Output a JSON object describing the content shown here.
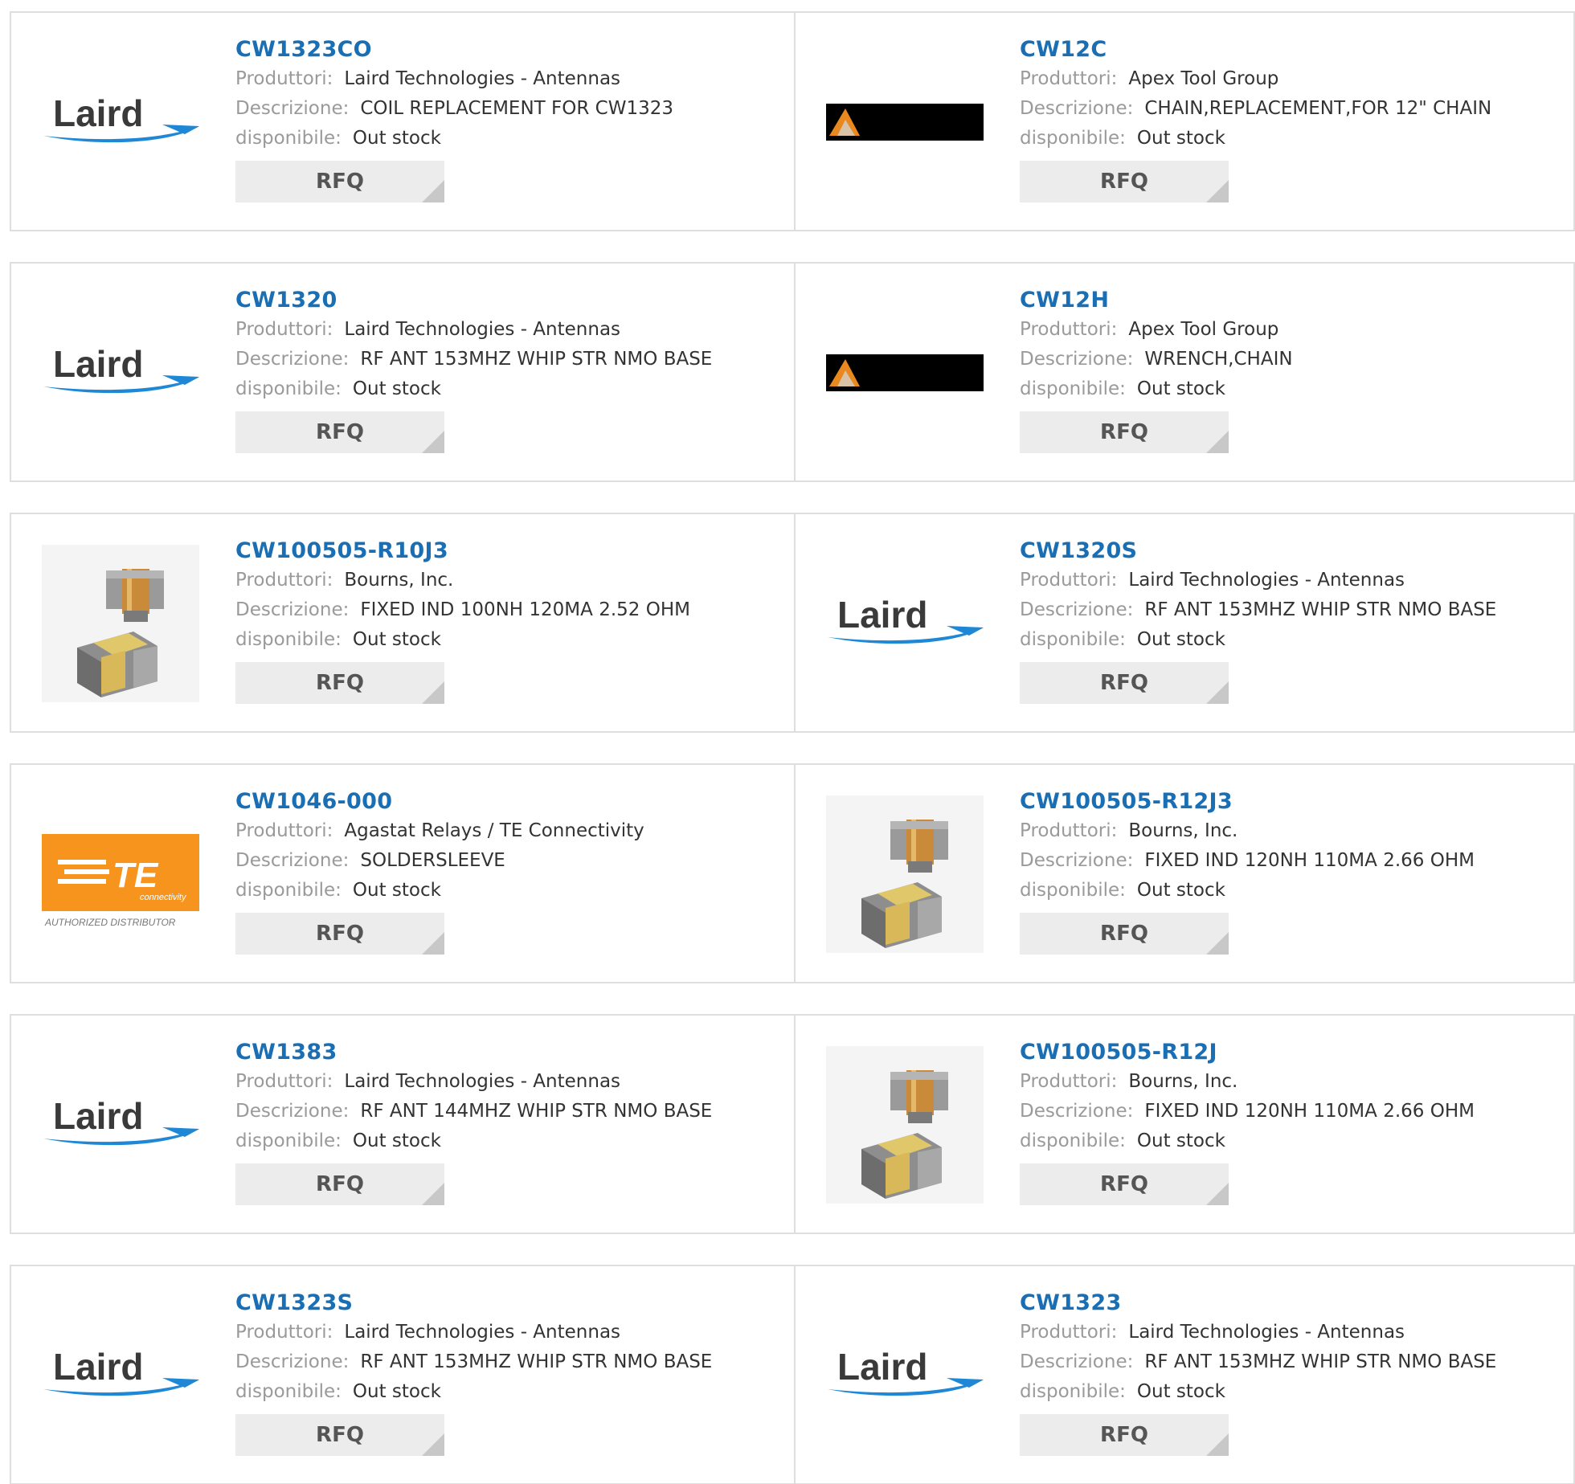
{
  "labels": {
    "manufacturer": "Produttori:",
    "description": "Descrizione:",
    "availability": "disponibile:",
    "rfq": "RFQ"
  },
  "brand_colors": {
    "link": "#1a6fb4",
    "laird_blue": "#1e88d6",
    "te_orange": "#f7941d"
  },
  "logos": {
    "laird": "Laird",
    "te_brand": "TE",
    "te_sub": "connectivity",
    "te_caption": "AUTHORIZED DISTRIBUTOR"
  },
  "products": [
    {
      "part": "CW1323CO",
      "manufacturer": "Laird Technologies - Antennas",
      "description": "COIL REPLACEMENT FOR CW1323",
      "availability": "Out stock",
      "logo": "laird-logo"
    },
    {
      "part": "CW12C",
      "manufacturer": "Apex Tool Group",
      "description": "CHAIN,REPLACEMENT,FOR 12\" CHAIN",
      "availability": "Out stock",
      "logo": "apex-logo"
    },
    {
      "part": "CW1320",
      "manufacturer": "Laird Technologies - Antennas",
      "description": "RF ANT 153MHZ WHIP STR NMO BASE",
      "availability": "Out stock",
      "logo": "laird-logo"
    },
    {
      "part": "CW12H",
      "manufacturer": "Apex Tool Group",
      "description": "WRENCH,CHAIN",
      "availability": "Out stock",
      "logo": "apex-logo"
    },
    {
      "part": "CW100505-R10J3",
      "manufacturer": "Bourns, Inc.",
      "description": "FIXED IND 100NH 120MA 2.52 OHM",
      "availability": "Out stock",
      "logo": "inductor-image"
    },
    {
      "part": "CW1320S",
      "manufacturer": "Laird Technologies - Antennas",
      "description": "RF ANT 153MHZ WHIP STR NMO BASE",
      "availability": "Out stock",
      "logo": "laird-logo"
    },
    {
      "part": "CW1046-000",
      "manufacturer": "Agastat Relays / TE Connectivity",
      "description": "SOLDERSLEEVE",
      "availability": "Out stock",
      "logo": "te-logo"
    },
    {
      "part": "CW100505-R12J3",
      "manufacturer": "Bourns, Inc.",
      "description": "FIXED IND 120NH 110MA 2.66 OHM",
      "availability": "Out stock",
      "logo": "inductor-image"
    },
    {
      "part": "CW1383",
      "manufacturer": "Laird Technologies - Antennas",
      "description": "RF ANT 144MHZ WHIP STR NMO BASE",
      "availability": "Out stock",
      "logo": "laird-logo"
    },
    {
      "part": "CW100505-R12J",
      "manufacturer": "Bourns, Inc.",
      "description": "FIXED IND 120NH 110MA 2.66 OHM",
      "availability": "Out stock",
      "logo": "inductor-image"
    },
    {
      "part": "CW1323S",
      "manufacturer": "Laird Technologies - Antennas",
      "description": "RF ANT 153MHZ WHIP STR NMO BASE",
      "availability": "Out stock",
      "logo": "laird-logo"
    },
    {
      "part": "CW1323",
      "manufacturer": "Laird Technologies - Antennas",
      "description": "RF ANT 153MHZ WHIP STR NMO BASE",
      "availability": "Out stock",
      "logo": "laird-logo"
    }
  ]
}
